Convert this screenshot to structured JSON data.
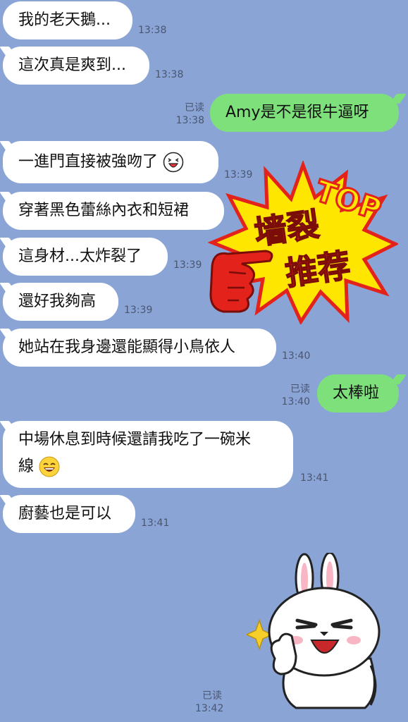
{
  "messages": [
    {
      "text": "我的老天鵝...",
      "time": "13:38"
    },
    {
      "text": "這次真是爽到...",
      "time": "13:38"
    },
    {
      "text": "Amy是不是很牛逼呀",
      "time": "13:38",
      "read": "已读"
    },
    {
      "text": "一進門直接被強吻了",
      "time": "13:39",
      "emoji": "grin-face-icon"
    },
    {
      "text": "穿著黑色蕾絲內衣和短裙"
    },
    {
      "text": "這身材...太炸裂了",
      "time": "13:39"
    },
    {
      "text": "還好我夠高",
      "time": "13:39"
    },
    {
      "text": "她站在我身邊還能顯得小鳥依人",
      "time": "13:40"
    },
    {
      "text": "太棒啦",
      "time": "13:40",
      "read": "已读"
    },
    {
      "text_line1": "中場休息到時候還請我吃了一碗米",
      "text_line2": "線",
      "time": "13:41",
      "emoji": "laughing-face-icon"
    },
    {
      "text": "廚藝也是可以",
      "time": "13:41"
    }
  ],
  "sticker": {
    "read": "已读",
    "time": "13:42",
    "name": "bunny-thumbs-up-icon"
  },
  "badge": {
    "top_text": "TOP",
    "line1": "墙裂",
    "line2": "推荐"
  },
  "colors": {
    "background": "#8aa4d6",
    "incoming": "#ffffff",
    "outgoing": "#7ee07a",
    "badge_yellow": "#ffe600",
    "badge_red": "#e3231b"
  }
}
